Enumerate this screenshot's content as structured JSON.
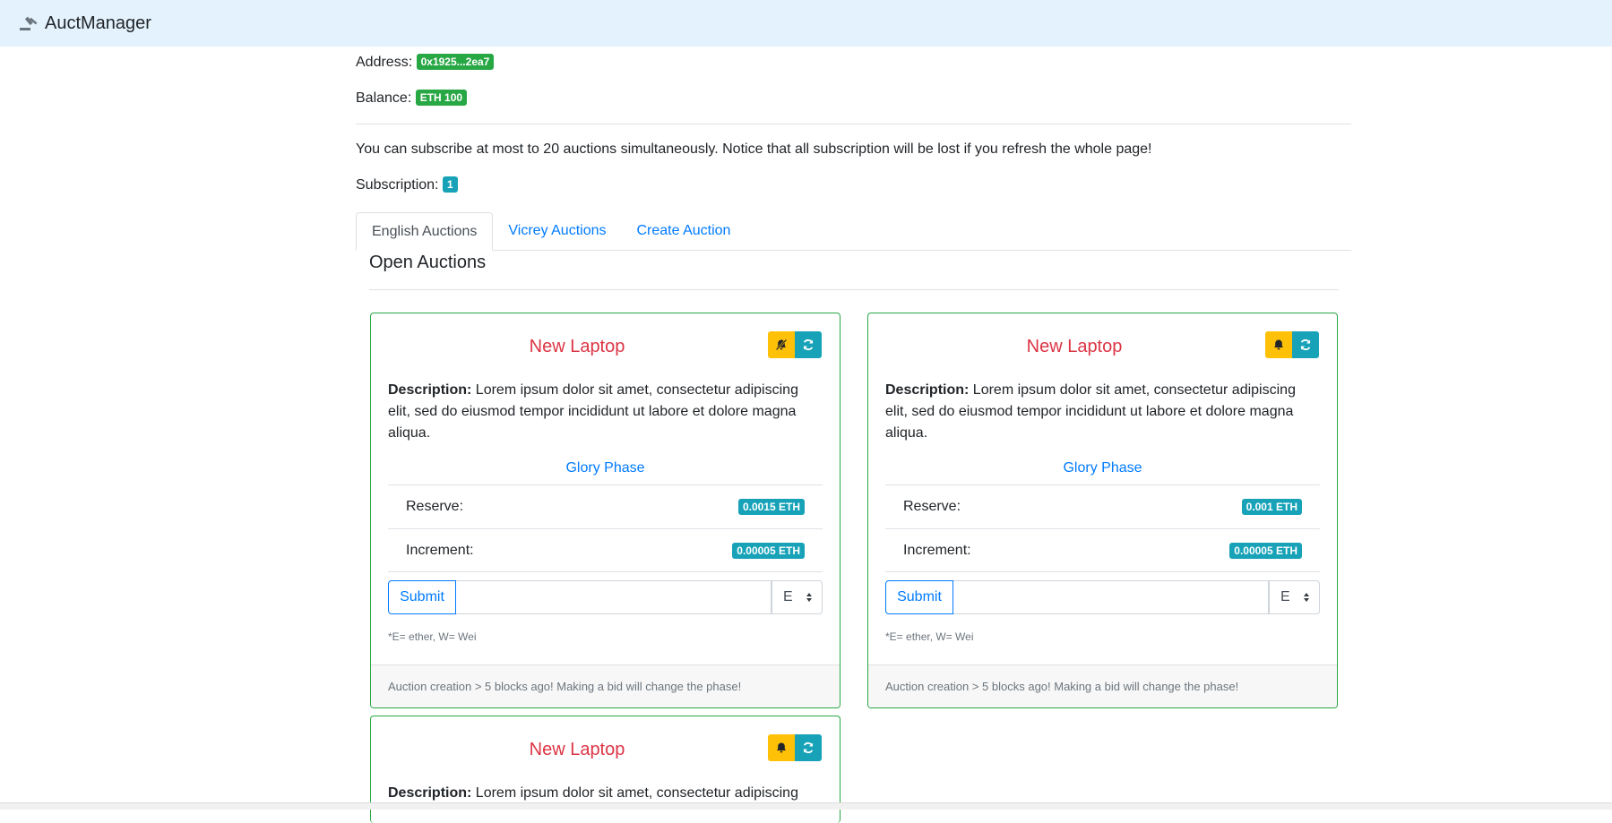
{
  "app": {
    "name": "AuctManager"
  },
  "account": {
    "address_label": "Address:",
    "address_value": "0x1925...2ea7",
    "balance_label": "Balance:",
    "balance_value": "ETH 100"
  },
  "notice": "You can subscribe at most to 20 auctions simultaneously. Notice that all subscription will be lost if you refresh the whole page!",
  "subscription": {
    "label": "Subscription:",
    "count": "1"
  },
  "tabs": [
    {
      "label": "English Auctions",
      "active": true
    },
    {
      "label": "Vicrey Auctions",
      "active": false
    },
    {
      "label": "Create Auction",
      "active": false
    }
  ],
  "section_title": "Open Auctions",
  "auctions": [
    {
      "title": "New Laptop",
      "subscribe_icon": "bell-slash-icon",
      "description_label": "Description:",
      "description": "Lorem ipsum dolor sit amet, consectetur adipiscing elit, sed do eiusmod tempor incididunt ut labore et dolore magna aliqua.",
      "phase": "Glory Phase",
      "reserve_label": "Reserve:",
      "reserve_value": "0.0015 ETH",
      "increment_label": "Increment:",
      "increment_value": "0.00005 ETH",
      "submit_label": "Submit",
      "bid_value": "",
      "unit_selected": "E",
      "hint": "*E= ether, W= Wei",
      "footer": "Auction creation > 5 blocks ago! Making a bid will change the phase!"
    },
    {
      "title": "New Laptop",
      "subscribe_icon": "bell-icon",
      "description_label": "Description:",
      "description": "Lorem ipsum dolor sit amet, consectetur adipiscing elit, sed do eiusmod tempor incididunt ut labore et dolore magna aliqua.",
      "phase": "Glory Phase",
      "reserve_label": "Reserve:",
      "reserve_value": "0.001 ETH",
      "increment_label": "Increment:",
      "increment_value": "0.00005 ETH",
      "submit_label": "Submit",
      "bid_value": "",
      "unit_selected": "E",
      "hint": "*E= ether, W= Wei",
      "footer": "Auction creation > 5 blocks ago! Making a bid will change the phase!"
    },
    {
      "title": "New Laptop",
      "subscribe_icon": "bell-icon",
      "description_label": "Description:",
      "description": "Lorem ipsum dolor sit amet, consectetur adipiscing"
    }
  ],
  "colors": {
    "navbar_bg": "#e3f2fd",
    "title_red": "#dc3545",
    "link_blue": "#007bff",
    "card_border": "#28a745",
    "badge_green": "#28a745",
    "badge_teal": "#17a2b8",
    "btn_yellow": "#ffc107"
  }
}
